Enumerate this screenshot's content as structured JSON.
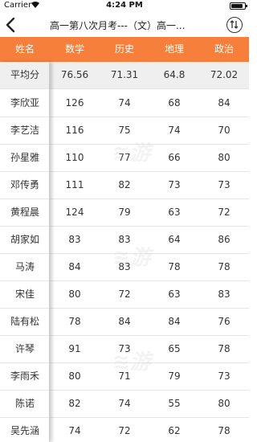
{
  "status_bar": {
    "carrier": "Carrier",
    "time": "4:24 PM",
    "battery_level": 0.9
  },
  "nav": {
    "title": "高一第八次月考---（文）高一...",
    "back_icon": "chevron-left-icon",
    "share_icon": "share-circle-icon"
  },
  "table": {
    "headers": [
      "姓名",
      "数学",
      "历史",
      "地理",
      "政治"
    ],
    "average": {
      "name": "平均分",
      "scores": [
        "76.56",
        "71.31",
        "64.8",
        "72.02"
      ]
    },
    "rows": [
      {
        "name": "李欣亚",
        "scores": [
          "126",
          "74",
          "68",
          "84"
        ]
      },
      {
        "name": "李艺洁",
        "scores": [
          "116",
          "75",
          "74",
          "70"
        ]
      },
      {
        "name": "孙星雅",
        "scores": [
          "110",
          "77",
          "66",
          "80"
        ]
      },
      {
        "name": "邓传勇",
        "scores": [
          "111",
          "82",
          "73",
          "73"
        ]
      },
      {
        "name": "黄程晨",
        "scores": [
          "124",
          "79",
          "63",
          "72"
        ]
      },
      {
        "name": "胡家如",
        "scores": [
          "83",
          "83",
          "64",
          "86"
        ]
      },
      {
        "name": "马涛",
        "scores": [
          "84",
          "83",
          "78",
          "78"
        ]
      },
      {
        "name": "宋佳",
        "scores": [
          "80",
          "72",
          "63",
          "83"
        ]
      },
      {
        "name": "陆有松",
        "scores": [
          "78",
          "84",
          "84",
          "76"
        ]
      },
      {
        "name": "许琴",
        "scores": [
          "91",
          "73",
          "65",
          "78"
        ]
      },
      {
        "name": "李雨禾",
        "scores": [
          "80",
          "71",
          "79",
          "73"
        ]
      },
      {
        "name": "陈诺",
        "scores": [
          "82",
          "74",
          "55",
          "80"
        ]
      },
      {
        "name": "吴先涵",
        "scores": [
          "74",
          "72",
          "62",
          "78"
        ]
      }
    ]
  },
  "colors": {
    "header_bg": "#f77f3c",
    "header_text": "#ffffff",
    "avg_row_bg": "#efefef"
  }
}
